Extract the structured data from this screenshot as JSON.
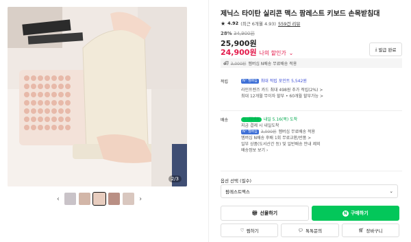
{
  "gallery": {
    "counter": "2/3",
    "prev_icon": "‹",
    "next_icon": "›",
    "thumb_count": 5
  },
  "product": {
    "title": "제닉스 타이탄 실리콘 맥스 팜레스트 키보드 손목받침대",
    "rating": "4.92",
    "rating_detail": "(최근 6개월 4.93)",
    "review_count": "559건 리뷰"
  },
  "price": {
    "discount_percent": "28%",
    "original": "34,900원",
    "sale": "25,900원",
    "my_price": "24,900원",
    "my_price_label": "나의 할인가",
    "coupon_button": "발급 완료"
  },
  "delivery_strip": {
    "strike_fee": "3,000원",
    "text": "멤버십 N배송 무료배송 적용"
  },
  "points": {
    "label": "적립",
    "badge": "N⁺ 멤버십",
    "max_points": "최대 적립 포인트 5,542원",
    "card_text": "라인프렌즈 카드 최대 498원 추가 적립(2%) >",
    "installment": "최대 12개월 무이자 할부 • 60개월 할부가능 >"
  },
  "shipping": {
    "label": "배송",
    "arrival_badge": "N 내일배송",
    "arrival_text": "내일 5.16(목) 도착",
    "order_note": "지금 결제 시 내일도착",
    "badge": "N⁺ 멤버십",
    "strike_fee": "3,000원",
    "free_text": "멤버십 무료배송 적용",
    "limit_text": "멤버십 N배송 후배 1회 무료교환/반품 >",
    "other_text": "일부 상품(도서산간 등) 및 일반배송 안내 제외",
    "more": "배송정보 보기 ›"
  },
  "options": {
    "label": "옵션 선택 (필수)",
    "selected": "팜레스트맥스"
  },
  "buttons": {
    "gift": "선물하기",
    "buy": "구매하기",
    "wish": "찜하기",
    "talk": "톡톡문의",
    "cart": "장바구니"
  },
  "colors": {
    "accent_green": "#03c75a",
    "sale_red": "#e3194a"
  }
}
